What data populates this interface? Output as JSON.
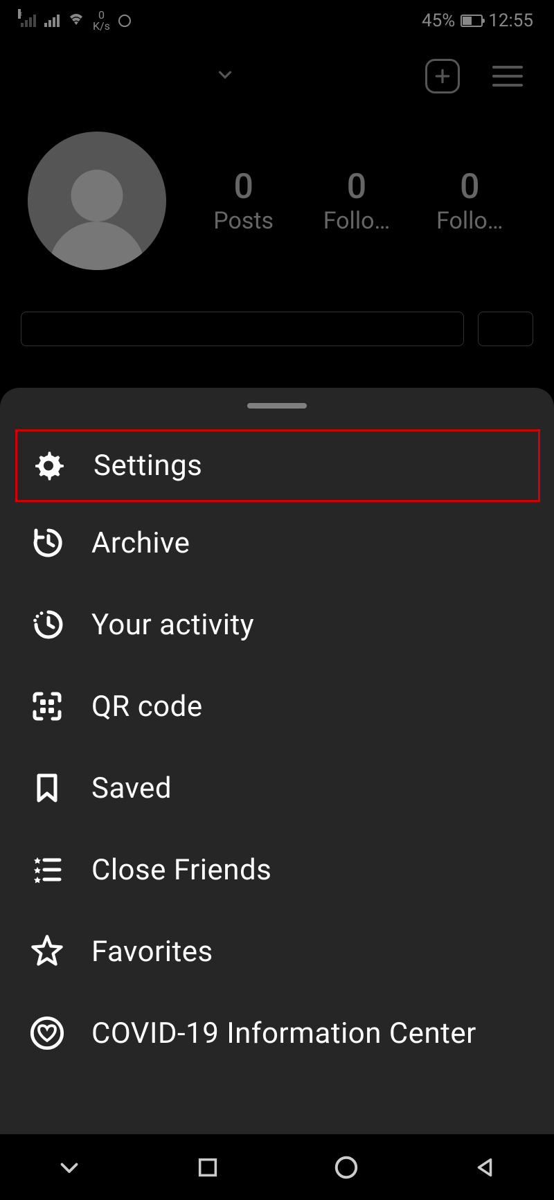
{
  "status_bar": {
    "speed_top": "0",
    "speed_bottom": "K/s",
    "battery_percent": "45%",
    "time": "12:55"
  },
  "profile": {
    "stats": {
      "posts_count": "0",
      "posts_label": "Posts",
      "followers_count": "0",
      "followers_label": "Follo…",
      "following_count": "0",
      "following_label": "Follo…"
    }
  },
  "menu": {
    "items": [
      {
        "icon": "gear-icon",
        "label": "Settings"
      },
      {
        "icon": "history-icon",
        "label": "Archive"
      },
      {
        "icon": "activity-icon",
        "label": "Your activity"
      },
      {
        "icon": "qr-icon",
        "label": "QR code"
      },
      {
        "icon": "bookmark-icon",
        "label": "Saved"
      },
      {
        "icon": "close-friends-icon",
        "label": "Close Friends"
      },
      {
        "icon": "star-icon",
        "label": "Favorites"
      },
      {
        "icon": "heart-circle-icon",
        "label": "COVID-19 Information Center"
      }
    ]
  }
}
